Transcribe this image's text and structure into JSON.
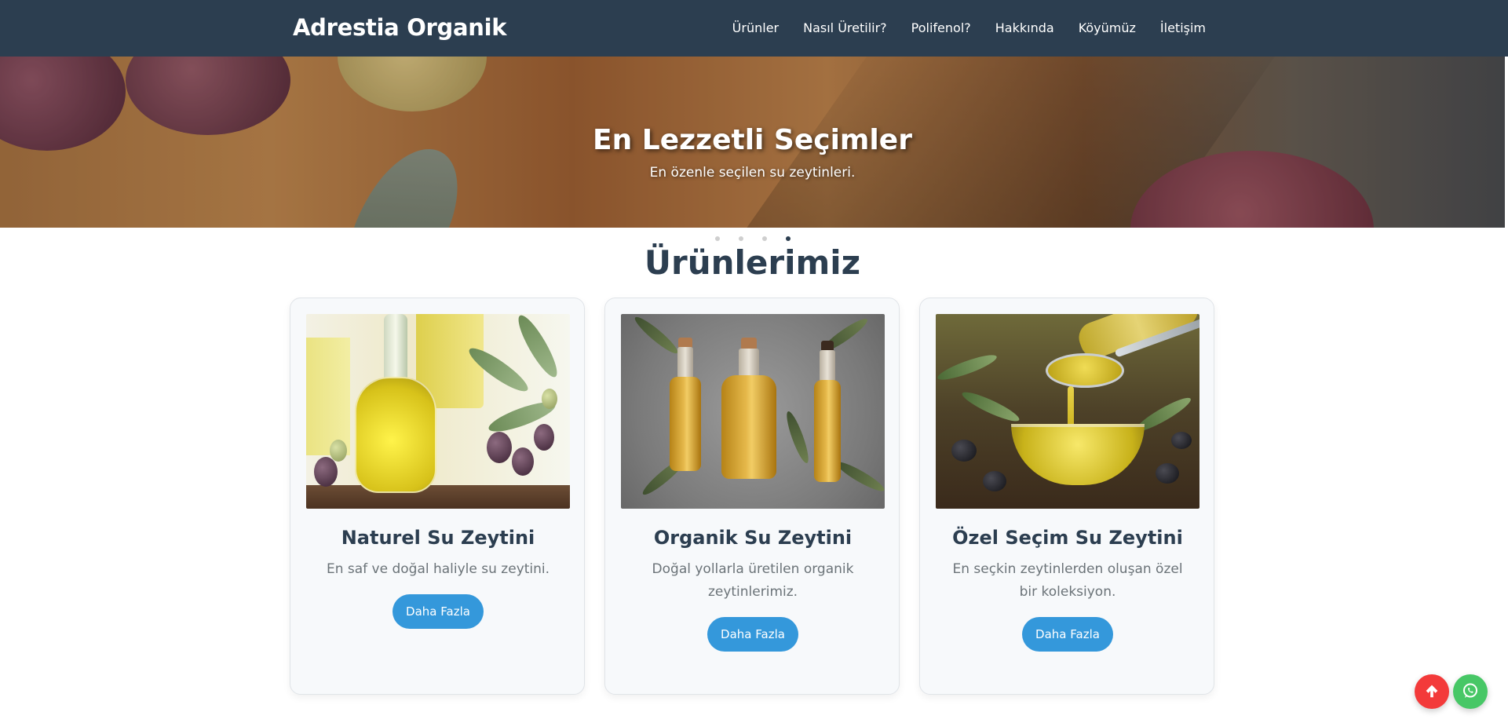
{
  "brand": "Adrestia Organik",
  "nav": {
    "items": [
      {
        "label": "Ürünler"
      },
      {
        "label": "Nasıl Üretilir?"
      },
      {
        "label": "Polifenol?"
      },
      {
        "label": "Hakkında"
      },
      {
        "label": "Köyümüz"
      },
      {
        "label": "İletişim"
      }
    ]
  },
  "hero": {
    "title": "En Lezzetli Seçimler",
    "subtitle": "En özenle seçilen su zeytinleri.",
    "slide_count": 4,
    "active_slide": 4
  },
  "products": {
    "title": "Ürünlerimiz",
    "items": [
      {
        "title": "Naturel Su Zeytini",
        "description": "En saf ve doğal haliyle su zeytini.",
        "button": "Daha Fazla"
      },
      {
        "title": "Organik Su Zeytini",
        "description": "Doğal yollarla üretilen organik zeytinlerimiz.",
        "button": "Daha Fazla"
      },
      {
        "title": "Özel Seçim Su Zeytini",
        "description": "En seçkin zeytinlerden oluşan özel bir koleksiyon.",
        "button": "Daha Fazla"
      }
    ]
  },
  "floating": {
    "scroll_top_icon": "arrow-up-icon",
    "whatsapp_icon": "whatsapp-icon"
  },
  "colors": {
    "navbar": "#2c3e50",
    "accent_button": "#3498db",
    "heading": "#2c3e50",
    "scroll_top": "#f33a3a",
    "whatsapp": "#47c766"
  }
}
